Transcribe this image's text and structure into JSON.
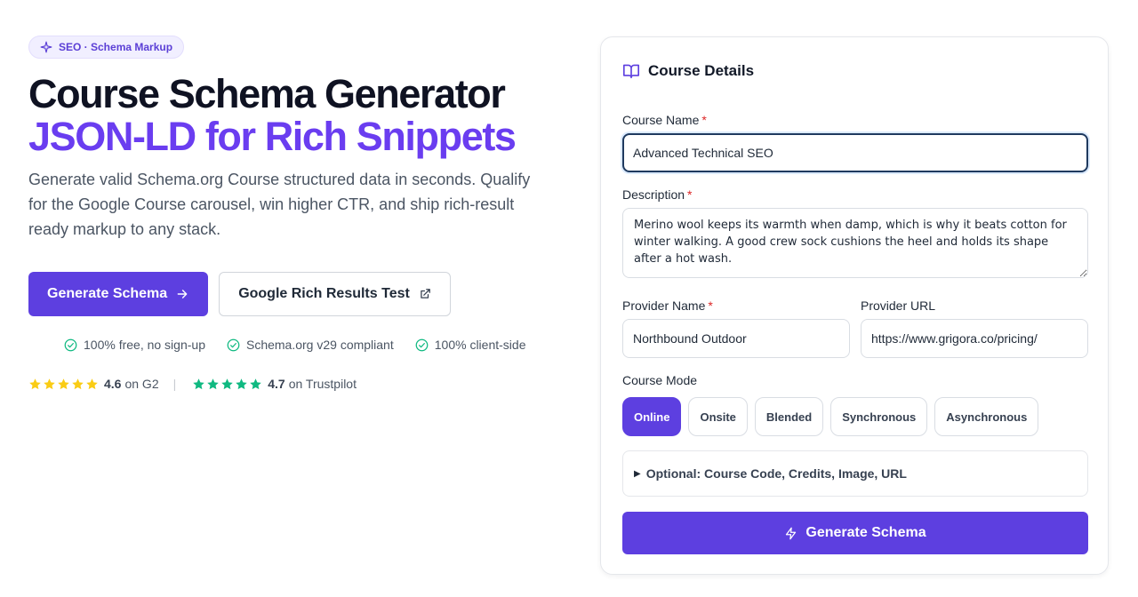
{
  "badge": {
    "icon": "sparkle-icon",
    "text": "SEO · Schema Markup"
  },
  "hero": {
    "title": "Course Schema Generator",
    "title_accent": "JSON-LD for Rich Snippets",
    "lead": "Generate valid Schema.org Course structured data in seconds. Qualify for the Google Course carousel, win higher CTR, and ship rich-result ready markup to any stack."
  },
  "cta": {
    "primary_label": "Generate Schema",
    "secondary_label": "Google Rich Results Test"
  },
  "checks": [
    {
      "text": "100% free, no sign-up"
    },
    {
      "text": "Schema.org v29 compliant"
    },
    {
      "text": "100% client-side"
    }
  ],
  "ratings": [
    {
      "value": "4.6",
      "source": "on G2",
      "star_color": "#facc15",
      "stars": 5
    },
    {
      "value": "4.7",
      "source": "on Trustpilot",
      "star_color": "#10b981",
      "stars": 5
    }
  ],
  "form": {
    "title": "Course Details",
    "course_name": {
      "label": "Course Name",
      "value": "Advanced Technical SEO"
    },
    "description": {
      "label": "Description",
      "value": "Merino wool keeps its warmth when damp, which is why it beats cotton for winter walking. A good crew sock cushions the heel and holds its shape after a hot wash."
    },
    "provider_name": {
      "label": "Provider Name",
      "value": "Northbound Outdoor"
    },
    "provider_url": {
      "label": "Provider URL",
      "value": "https://www.grigora.co/pricing/"
    },
    "course_mode": {
      "label": "Course Mode",
      "options": [
        "Online",
        "Onsite",
        "Blended",
        "Synchronous",
        "Asynchronous"
      ],
      "selected": "Online"
    },
    "optional_label": "Optional: Course Code, Credits, Image, URL",
    "generate_label": "Generate Schema"
  },
  "colors": {
    "accent": "#5d3fe0",
    "accent_text": "#6a3df0",
    "check": "#10b981",
    "required": "#dc2626"
  }
}
